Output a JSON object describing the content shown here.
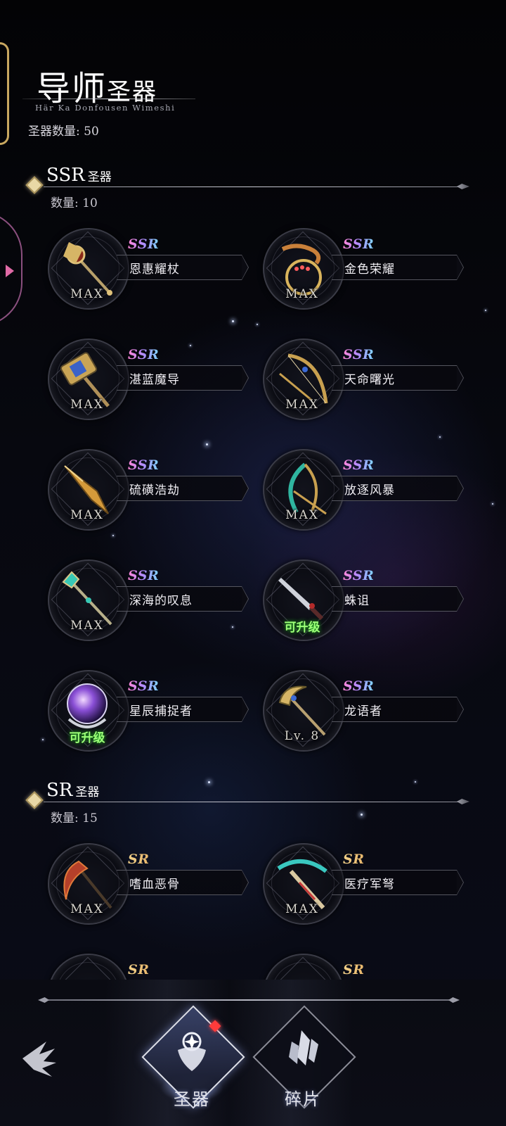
{
  "header": {
    "title_part1": "导师",
    "title_part2": "圣器",
    "subtitle": "Här Ka Donfousen Wimeshi",
    "total_label": "圣器数量: 50"
  },
  "sections": [
    {
      "tier": "SSR",
      "tier_suffix": "圣器",
      "count_label": "数量: 10",
      "items": [
        {
          "rarity": "SSR",
          "name": "恩惠耀杖",
          "status": "MAX"
        },
        {
          "rarity": "SSR",
          "name": "金色荣耀",
          "status": "MAX"
        },
        {
          "rarity": "SSR",
          "name": "湛蓝魔导",
          "status": "MAX"
        },
        {
          "rarity": "SSR",
          "name": "天命曙光",
          "status": "MAX"
        },
        {
          "rarity": "SSR",
          "name": "硫磺浩劫",
          "status": "MAX"
        },
        {
          "rarity": "SSR",
          "name": "放逐风暴",
          "status": "MAX"
        },
        {
          "rarity": "SSR",
          "name": "深海的叹息",
          "status": "MAX"
        },
        {
          "rarity": "SSR",
          "name": "蛛诅",
          "status": "可升级"
        },
        {
          "rarity": "SSR",
          "name": "星辰捕捉者",
          "status": "可升级"
        },
        {
          "rarity": "SSR",
          "name": "龙语者",
          "status": "Lv. 8"
        }
      ]
    },
    {
      "tier": "SR",
      "tier_suffix": "圣器",
      "count_label": "数量: 15",
      "items": [
        {
          "rarity": "SR",
          "name": "嗜血恶骨",
          "status": "MAX"
        },
        {
          "rarity": "SR",
          "name": "医疗军弩",
          "status": "MAX"
        },
        {
          "rarity": "SR",
          "name": "",
          "status": ""
        },
        {
          "rarity": "SR",
          "name": "",
          "status": ""
        }
      ]
    }
  ],
  "tabs": [
    {
      "label": "圣器",
      "active": true,
      "icon": "artifact-emblem-icon",
      "has_notification": true
    },
    {
      "label": "碎片",
      "active": false,
      "icon": "crystal-shards-icon",
      "has_notification": false
    }
  ],
  "back_button": {
    "icon": "back-arrow-icon"
  },
  "colors": {
    "ssr_gradient": [
      "#ff86d8",
      "#b08cff",
      "#7fd6ff"
    ],
    "sr_gold": "#f2d28a",
    "upgradable_green": "#9cff78",
    "notification_red": "#ff3b3b"
  }
}
